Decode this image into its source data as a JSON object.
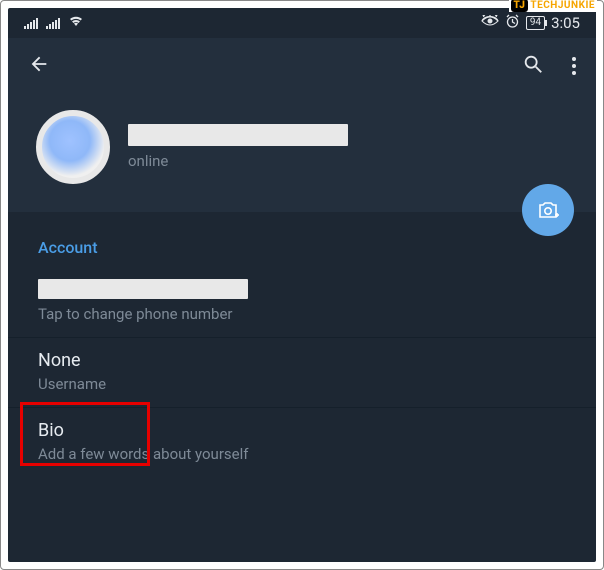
{
  "watermark": {
    "badge": "TJ",
    "text": "TECHJUNKIE"
  },
  "status_bar": {
    "battery_percent": "94",
    "time": "3:05"
  },
  "profile": {
    "status": "online"
  },
  "section_header": "Account",
  "settings": {
    "phone": {
      "desc": "Tap to change phone number"
    },
    "username": {
      "value": "None",
      "desc": "Username"
    },
    "bio": {
      "value": "Bio",
      "desc": "Add a few words about yourself"
    }
  }
}
